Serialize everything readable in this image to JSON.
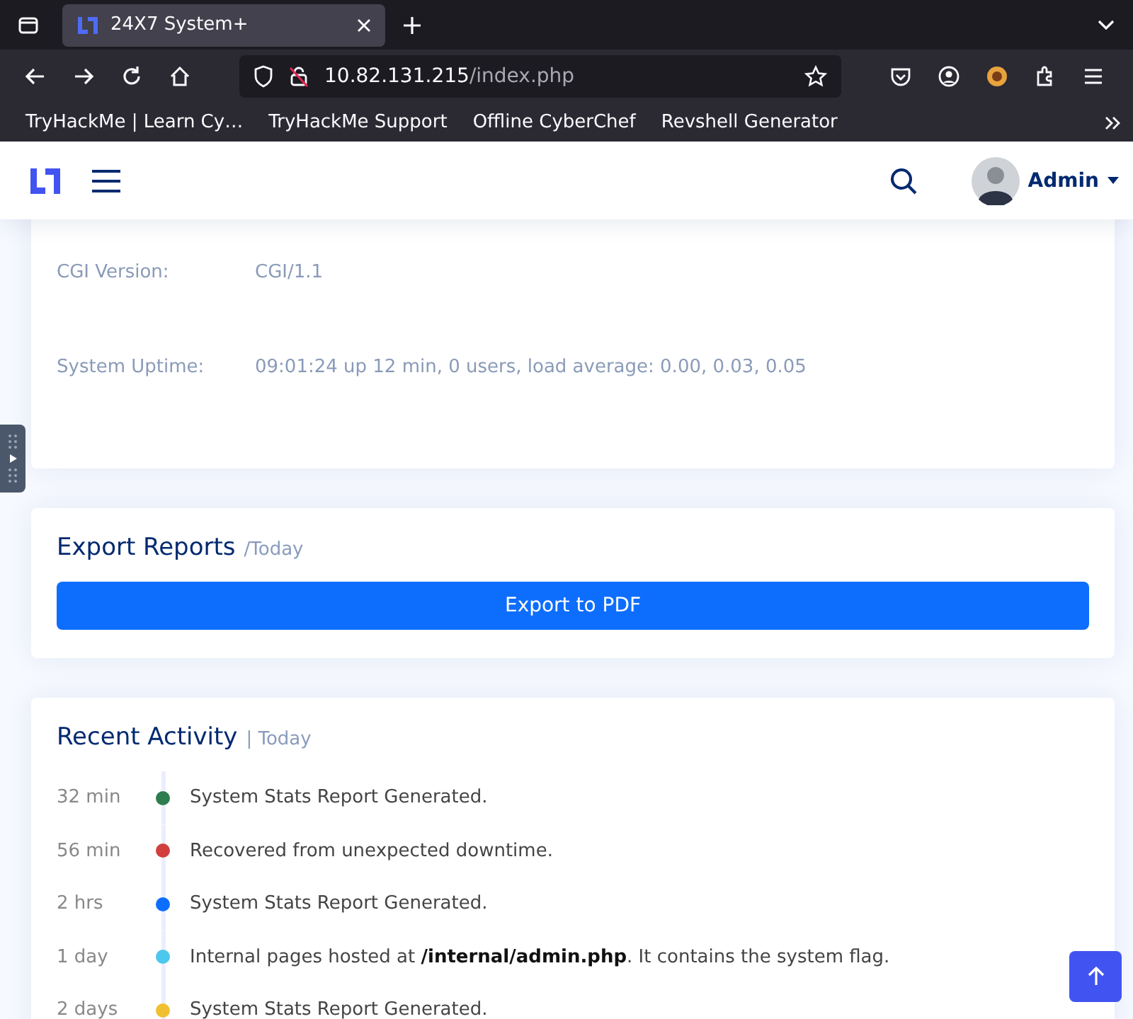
{
  "browser": {
    "tab_title": "24X7 System+",
    "url_host": "10.82.131.215",
    "url_path": "/index.php",
    "bookmarks": [
      "TryHackMe | Learn Cy…",
      "TryHackMe Support",
      "Offline CyberChef",
      "Revshell Generator"
    ]
  },
  "header": {
    "user_name": "Admin"
  },
  "system_info": [
    {
      "label": "CGI Version:",
      "value": "CGI/1.1"
    },
    {
      "label": "System Uptime:",
      "value": "09:01:24 up 12 min, 0 users, load average: 0.00, 0.03, 0.05"
    }
  ],
  "export_reports": {
    "title": "Export Reports",
    "subtitle": "/Today",
    "button": "Export to PDF"
  },
  "recent_activity": {
    "title": "Recent Activity",
    "subtitle": "| Today",
    "items": [
      {
        "time": "32 min",
        "text": "System Stats Report Generated.",
        "color": "#2e7d4f"
      },
      {
        "time": "56 min",
        "text": "Recovered from unexpected downtime.",
        "color": "#d13f3f"
      },
      {
        "time": "2 hrs",
        "text": "System Stats Report Generated.",
        "color": "#0d6efd"
      },
      {
        "time": "1 day",
        "text": "Internal pages hosted at **/internal/admin.php**. It contains the system flag.",
        "color": "#4cc7ee"
      },
      {
        "time": "2 days",
        "text": "System Stats Report Generated.",
        "color": "#f0c030"
      }
    ]
  }
}
